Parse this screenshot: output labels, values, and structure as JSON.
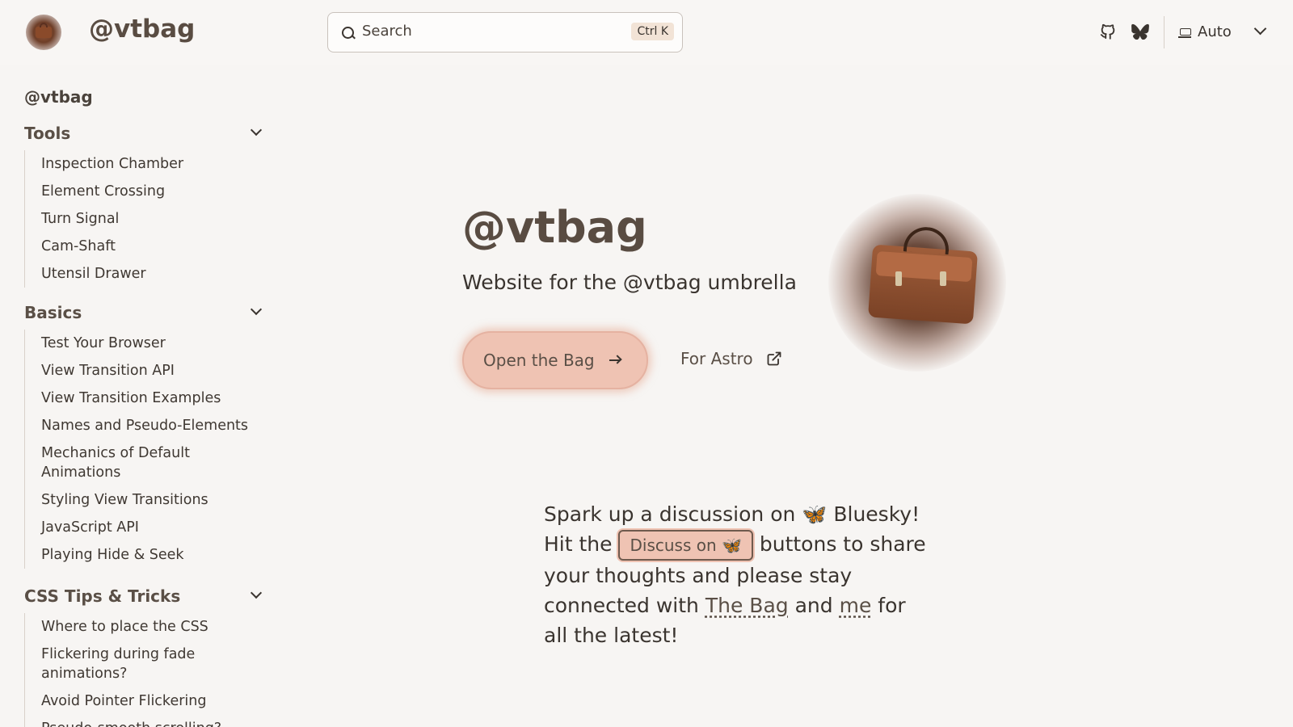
{
  "header": {
    "site_title": "@vtbag",
    "search_placeholder": "Search",
    "search_shortcut": "Ctrl K",
    "theme_label": "Auto",
    "icons": [
      "github-icon",
      "bluesky-icon",
      "laptop-icon",
      "chevron-down-icon"
    ]
  },
  "sidebar": {
    "top_link": "@vtbag",
    "groups": [
      {
        "title": "Tools",
        "items": [
          "Inspection Chamber",
          "Element Crossing",
          "Turn Signal",
          "Cam-Shaft",
          "Utensil Drawer"
        ]
      },
      {
        "title": "Basics",
        "items": [
          "Test Your Browser",
          "View Transition API",
          "View Transition Examples",
          "Names and Pseudo-Elements",
          "Mechanics of Default Animations",
          "Styling View Transitions",
          "JavaScript API",
          "Playing Hide & Seek"
        ]
      },
      {
        "title": "CSS Tips & Tricks",
        "items": [
          "Where to place the CSS",
          "Flickering during fade animations?",
          "Avoid Pointer Flickering",
          "Pseudo-smooth scrolling?"
        ]
      }
    ]
  },
  "hero": {
    "title": "@vtbag",
    "tagline": "Website for the @vtbag umbrella",
    "primary_action": "Open the Bag",
    "secondary_action": "For Astro"
  },
  "note": {
    "line1": "Spark up a discussion on 🦋 Bluesky!",
    "hit_the": "Hit the",
    "discuss_button": "Discuss on 🦋",
    "after_button": "buttons to share your thoughts and please stay connected with",
    "link_bag": "The Bag",
    "and": "and",
    "link_me": "me",
    "ending": "for all the latest!"
  },
  "colors": {
    "background": "#f7f5f3",
    "accent": "#efc3b3",
    "title": "#594c42",
    "text": "#3a342f"
  }
}
